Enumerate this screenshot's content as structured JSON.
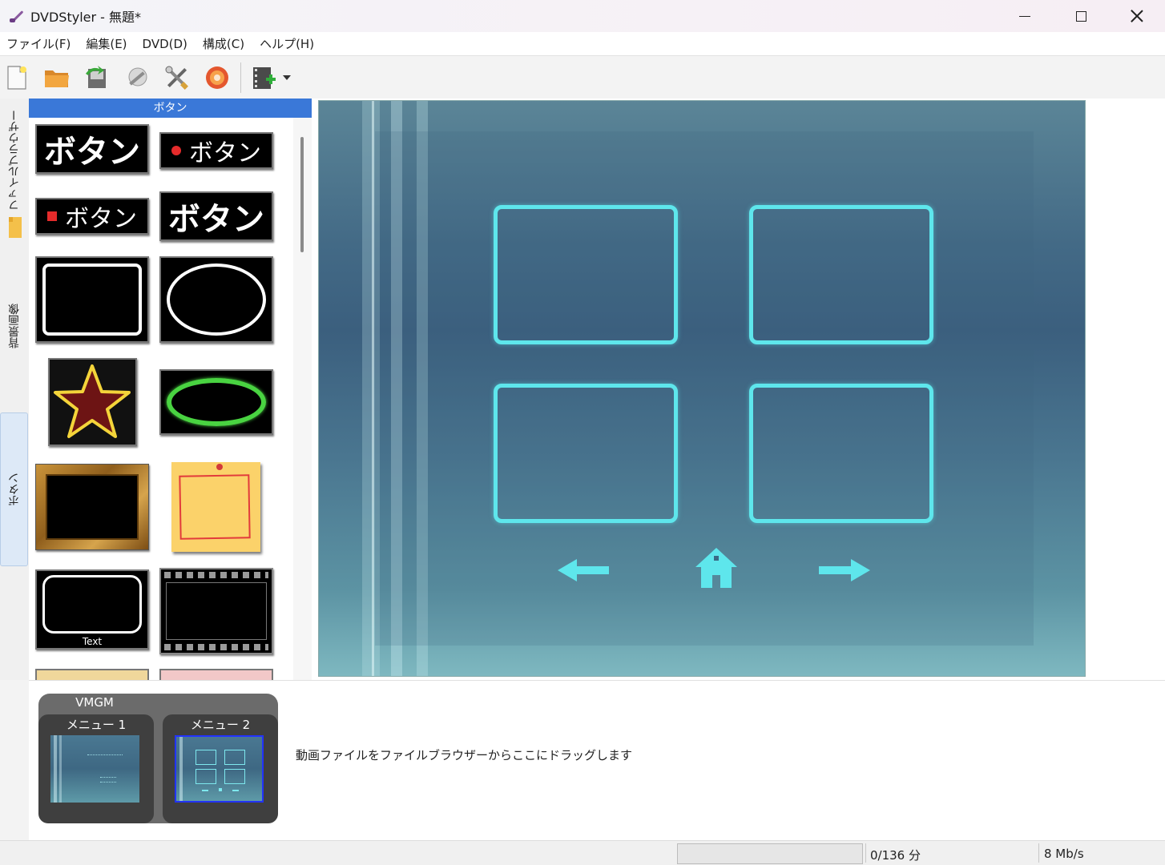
{
  "window": {
    "title": "DVDStyler - 無題*"
  },
  "menubar": {
    "items": [
      "ファイル(F)",
      "編集(E)",
      "DVD(D)",
      "構成(C)",
      "ヘルプ(H)"
    ]
  },
  "toolbar": {
    "buttons": [
      "new-project-icon",
      "open-folder-icon",
      "save-icon",
      "run-wrench-icon",
      "settings-tools-icon",
      "burn-disc-icon",
      "add-video-icon"
    ]
  },
  "left_tabs": {
    "file_browser": "ファイルブラウザー",
    "backgrounds": "背景画像",
    "buttons": "ボタン"
  },
  "palette": {
    "header": "ボタン",
    "sample_text": "ボタン",
    "frame_caption": "Text"
  },
  "titleset": {
    "vmgm_label": "VMGM",
    "menu1_label": "メニュー 1",
    "menu2_label": "メニュー 2",
    "drop_hint": "動画ファイルをファイルブラウザーからここにドラッグします"
  },
  "statusbar": {
    "progress_fraction": 0,
    "duration": "0/136 分",
    "bitrate": "8 Mb/s"
  },
  "colors": {
    "palette_header": "#3a78d8",
    "frame_cyan": "#5ee6ec",
    "selection_blue": "#2233ff"
  }
}
